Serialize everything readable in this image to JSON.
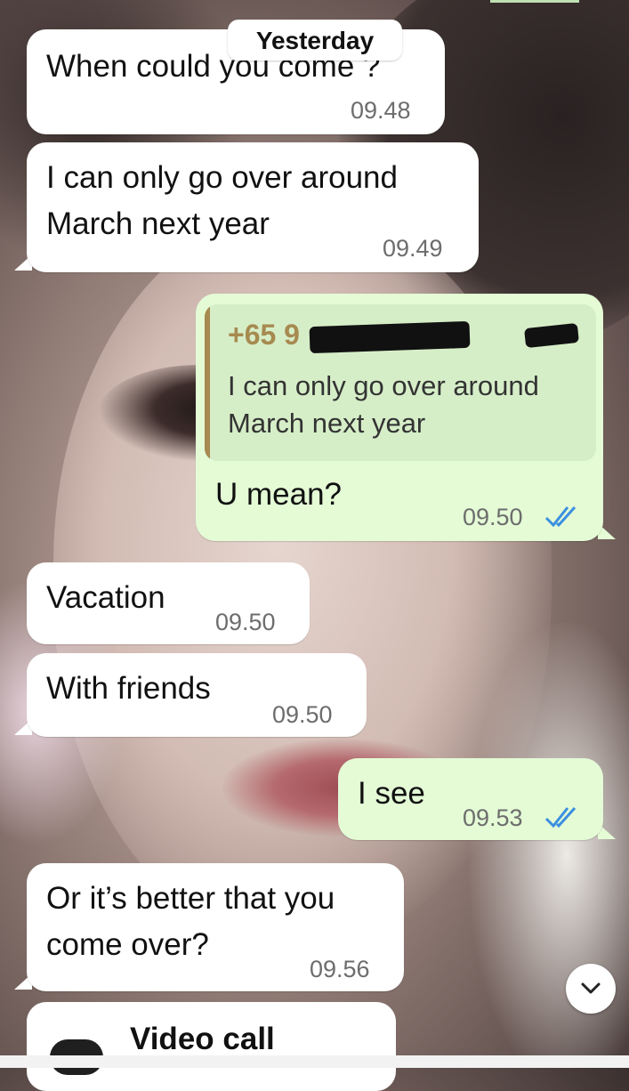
{
  "date_separator": "Yesterday",
  "messages": [
    {
      "text": "When could you come ?",
      "time": "09.48"
    },
    {
      "lines": [
        "I can only go over  around",
        "March next year"
      ],
      "time": "09.49"
    },
    {
      "reply": {
        "sender": "+65 9",
        "lines": [
          "I can only go over  around",
          "March next year"
        ]
      },
      "text": "U mean?",
      "time": "09.50",
      "status": "read-double-check-icon"
    },
    {
      "text": "Vacation",
      "time": "09.50"
    },
    {
      "text": "With friends",
      "time": "09.50"
    },
    {
      "text": "I see",
      "time": "09.53",
      "status": "read-double-check-icon"
    },
    {
      "lines": [
        "Or it’s better that you",
        "come over?"
      ],
      "time": "09.56"
    }
  ],
  "call": {
    "label": "Video call",
    "icon": "video-camera-icon"
  },
  "scroll_button": {
    "icon": "chevron-down-icon"
  },
  "colors": {
    "incoming": "#ffffff",
    "outgoing": "#e4fbd6",
    "read_ticks": "#3b8fe0",
    "quote_accent": "#a68a50"
  }
}
